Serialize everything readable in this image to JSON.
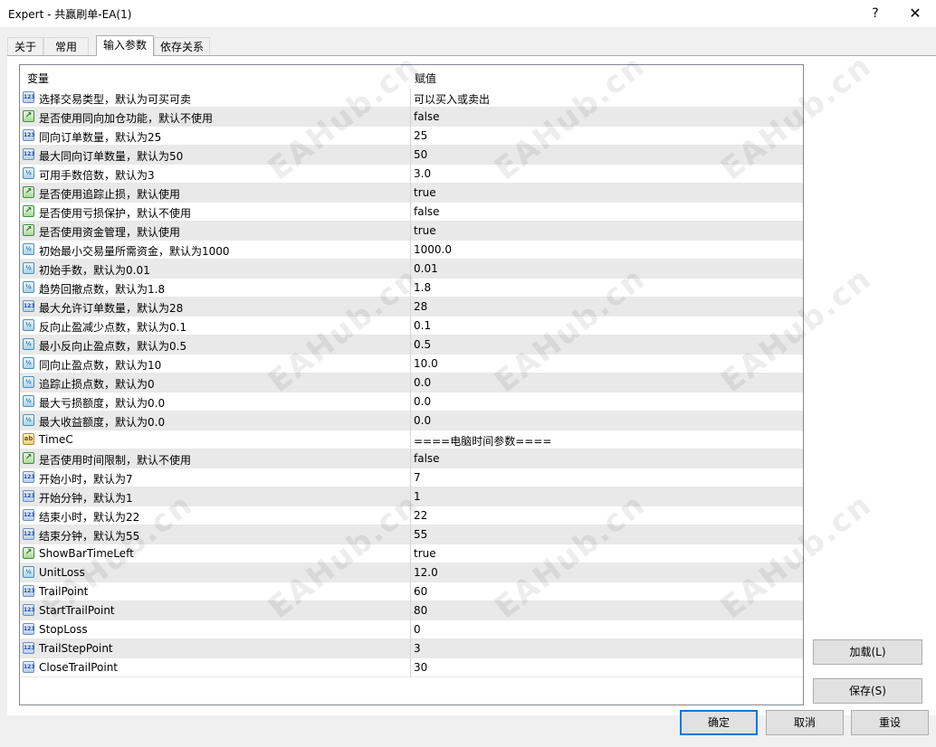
{
  "window": {
    "title": "Expert - 共赢刷单-EA(1)",
    "help_glyph": "?",
    "close_glyph": "✕"
  },
  "tabs": [
    {
      "label": "关于"
    },
    {
      "label": "常用"
    },
    {
      "label": "输入参数",
      "active": true
    },
    {
      "label": "依存关系"
    }
  ],
  "grid": {
    "col_variable": "变量",
    "col_value": "赋值",
    "rows": [
      {
        "type": "int",
        "name": "选择交易类型，默认为可买可卖",
        "value": "可以买入或卖出"
      },
      {
        "type": "bool",
        "name": "是否使用同向加仓功能，默认不使用",
        "value": "false"
      },
      {
        "type": "int",
        "name": "同向订单数量，默认为25",
        "value": "25"
      },
      {
        "type": "int",
        "name": "最大同向订单数量，默认为50",
        "value": "50"
      },
      {
        "type": "double",
        "name": "可用手数倍数，默认为3",
        "value": "3.0"
      },
      {
        "type": "bool",
        "name": "是否使用追踪止损，默认使用",
        "value": "true"
      },
      {
        "type": "bool",
        "name": "是否使用亏损保护，默认不使用",
        "value": "false"
      },
      {
        "type": "bool",
        "name": "是否使用资金管理，默认使用",
        "value": "true"
      },
      {
        "type": "double",
        "name": "初始最小交易量所需资金，默认为1000",
        "value": "1000.0"
      },
      {
        "type": "double",
        "name": "初始手数，默认为0.01",
        "value": "0.01"
      },
      {
        "type": "double",
        "name": "趋势回撤点数，默认为1.8",
        "value": "1.8"
      },
      {
        "type": "int",
        "name": "最大允许订单数量，默认为28",
        "value": "28"
      },
      {
        "type": "double",
        "name": "反向止盈减少点数，默认为0.1",
        "value": "0.1"
      },
      {
        "type": "double",
        "name": "最小反向止盈点数，默认为0.5",
        "value": "0.5"
      },
      {
        "type": "double",
        "name": "同向止盈点数，默认为10",
        "value": "10.0"
      },
      {
        "type": "double",
        "name": "追踪止损点数，默认为0",
        "value": "0.0"
      },
      {
        "type": "double",
        "name": "最大亏损额度，默认为0.0",
        "value": "0.0"
      },
      {
        "type": "double",
        "name": "最大收益额度，默认为0.0",
        "value": "0.0"
      },
      {
        "type": "string",
        "name": "TimeC",
        "value": "====电脑时间参数===="
      },
      {
        "type": "bool",
        "name": "是否使用时间限制，默认不使用",
        "value": "false"
      },
      {
        "type": "int",
        "name": "开始小时，默认为7",
        "value": "7"
      },
      {
        "type": "int",
        "name": "开始分钟，默认为1",
        "value": "1"
      },
      {
        "type": "int",
        "name": "结束小时，默认为22",
        "value": "22"
      },
      {
        "type": "int",
        "name": "结束分钟，默认为55",
        "value": "55"
      },
      {
        "type": "bool",
        "name": "ShowBarTimeLeft",
        "value": "true"
      },
      {
        "type": "double",
        "name": "UnitLoss",
        "value": "12.0"
      },
      {
        "type": "int",
        "name": "TrailPoint",
        "value": "60"
      },
      {
        "type": "int",
        "name": "StartTrailPoint",
        "value": "80"
      },
      {
        "type": "int",
        "name": "StopLoss",
        "value": "0"
      },
      {
        "type": "int",
        "name": "TrailStepPoint",
        "value": "3"
      },
      {
        "type": "int",
        "name": "CloseTrailPoint",
        "value": "30"
      }
    ]
  },
  "icon_glyphs": {
    "int": "123",
    "bool": "↗",
    "double": "½",
    "string": "ab"
  },
  "buttons": {
    "load": "加载(L)",
    "save": "保存(S)",
    "ok": "确定",
    "cancel": "取消",
    "reset": "重设"
  },
  "watermark": "EAHub.cn"
}
